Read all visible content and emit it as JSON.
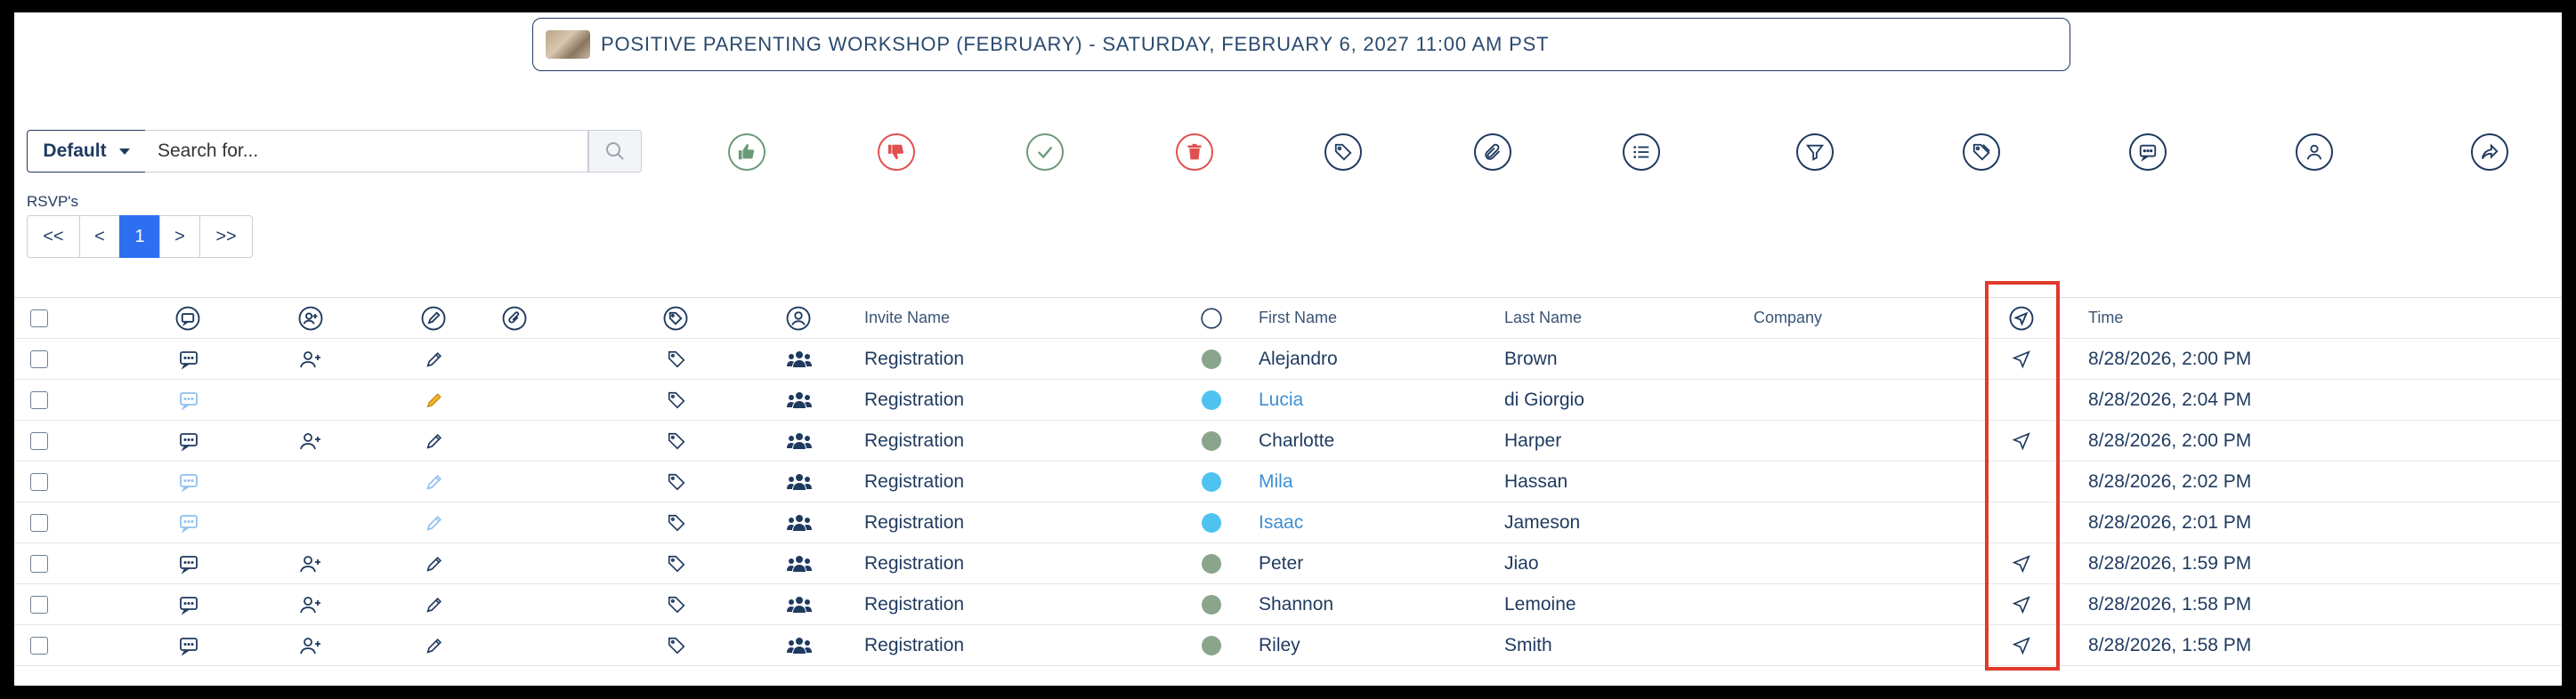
{
  "event": {
    "title": "POSITIVE PARENTING WORKSHOP (FEBRUARY) - SATURDAY, FEBRUARY 6, 2027 11:00 AM PST"
  },
  "toolbar": {
    "default_label": "Default",
    "search_placeholder": "Search for...",
    "icons": [
      "thumbs-up-icon",
      "thumbs-down-icon",
      "check-circle-icon",
      "trash-icon",
      "tag-icon",
      "paperclip-icon",
      "list-icon",
      "filter-icon",
      "tags-icon",
      "chat-icon",
      "user-circle-icon",
      "share-icon"
    ]
  },
  "pagination": {
    "label": "RSVP's",
    "buttons": [
      "<<",
      "<",
      "1",
      ">",
      ">>"
    ],
    "current": "1"
  },
  "table": {
    "headers": {
      "invite_name": "Invite Name",
      "first_name": "First Name",
      "last_name": "Last Name",
      "company": "Company",
      "time": "Time"
    },
    "rows": [
      {
        "invite": "Registration",
        "first": "Alejandro",
        "last": "Brown",
        "company": "",
        "time": "8/28/2026, 2:00 PM",
        "status": "green",
        "active": true
      },
      {
        "invite": "Registration",
        "first": "Lucia",
        "last": "di Giorgio",
        "company": "",
        "time": "8/28/2026, 2:04 PM",
        "status": "blue",
        "active": false
      },
      {
        "invite": "Registration",
        "first": "Charlotte",
        "last": "Harper",
        "company": "",
        "time": "8/28/2026, 2:00 PM",
        "status": "green",
        "active": true
      },
      {
        "invite": "Registration",
        "first": "Mila",
        "last": "Hassan",
        "company": "",
        "time": "8/28/2026, 2:02 PM",
        "status": "blue",
        "active": false
      },
      {
        "invite": "Registration",
        "first": "Isaac",
        "last": "Jameson",
        "company": "",
        "time": "8/28/2026, 2:01 PM",
        "status": "blue",
        "active": false
      },
      {
        "invite": "Registration",
        "first": "Peter",
        "last": "Jiao",
        "company": "",
        "time": "8/28/2026, 1:59 PM",
        "status": "green",
        "active": true
      },
      {
        "invite": "Registration",
        "first": "Shannon",
        "last": "Lemoine",
        "company": "",
        "time": "8/28/2026, 1:58 PM",
        "status": "green",
        "active": true
      },
      {
        "invite": "Registration",
        "first": "Riley",
        "last": "Smith",
        "company": "",
        "time": "8/28/2026, 1:58 PM",
        "status": "green",
        "active": true
      }
    ]
  },
  "colors": {
    "navy": "#1f3a5f",
    "status_green": "#8aa58c",
    "status_blue": "#4fc3f0",
    "link_blue": "#3d8fd6",
    "highlight_red": "#e03a2c"
  }
}
